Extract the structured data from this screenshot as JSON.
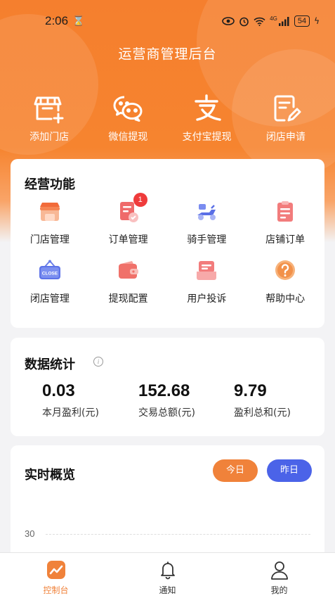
{
  "status_bar": {
    "time": "2:06",
    "battery": "54",
    "signal": "4G"
  },
  "header": {
    "title": "运营商管理后台"
  },
  "quick_actions": [
    {
      "label": "添加门店",
      "icon": "add-store-icon"
    },
    {
      "label": "微信提现",
      "icon": "wechat-icon"
    },
    {
      "label": "支付宝提现",
      "icon": "alipay-icon"
    },
    {
      "label": "闭店申请",
      "icon": "edit-document-icon"
    }
  ],
  "functions": {
    "title": "经营功能",
    "items": [
      {
        "label": "门店管理",
        "icon": "store-icon"
      },
      {
        "label": "订单管理",
        "icon": "order-icon",
        "badge": "1"
      },
      {
        "label": "骑手管理",
        "icon": "scooter-icon"
      },
      {
        "label": "店铺订单",
        "icon": "clipboard-icon"
      },
      {
        "label": "闭店管理",
        "icon": "close-sign-icon",
        "icon_text": "CLOSE"
      },
      {
        "label": "提现配置",
        "icon": "wallet-icon"
      },
      {
        "label": "用户投诉",
        "icon": "complaint-icon"
      },
      {
        "label": "帮助中心",
        "icon": "help-icon"
      }
    ]
  },
  "stats": {
    "title": "数据统计",
    "items": [
      {
        "value": "0.03",
        "label": "本月盈利(元)"
      },
      {
        "value": "152.68",
        "label": "交易总额(元)"
      },
      {
        "value": "9.79",
        "label": "盈利总和(元)"
      }
    ]
  },
  "overview": {
    "title": "实时概览",
    "today_label": "今日",
    "yesterday_label": "昨日",
    "axis_tick": "30"
  },
  "tabbar": [
    {
      "label": "控制台",
      "icon": "dashboard-icon",
      "active": true
    },
    {
      "label": "通知",
      "icon": "bell-icon",
      "active": false
    },
    {
      "label": "我的",
      "icon": "user-icon",
      "active": false
    }
  ],
  "colors": {
    "accent": "#f0823a",
    "blue": "#4b63e8",
    "badge": "#ef3b3b"
  }
}
